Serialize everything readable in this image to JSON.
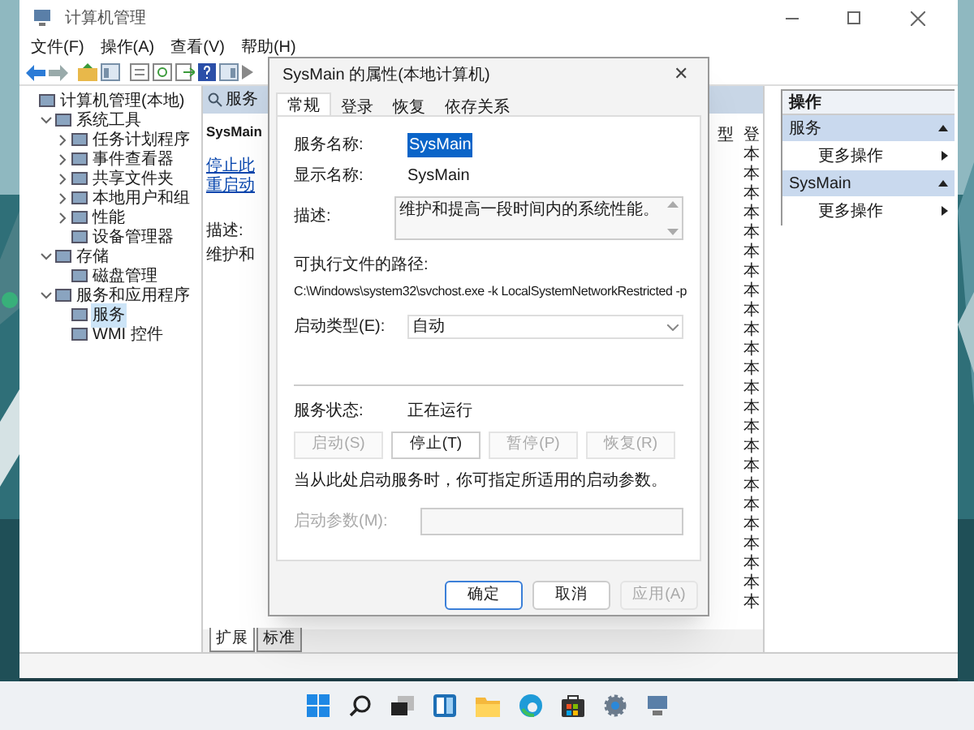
{
  "window": {
    "title": "计算机管理"
  },
  "menu": [
    "文件(F)",
    "操作(A)",
    "查看(V)",
    "帮助(H)"
  ],
  "tree": {
    "label": "计算机管理(本地)",
    "selected": false,
    "children": [
      {
        "label": "系统工具",
        "expanded": true,
        "selected": false,
        "children": [
          {
            "label": "任务计划程序",
            "expanded": false,
            "selected": false
          },
          {
            "label": "事件查看器",
            "expanded": false,
            "selected": false
          },
          {
            "label": "共享文件夹",
            "expanded": false,
            "selected": false
          },
          {
            "label": "本地用户和组",
            "expanded": false,
            "selected": false
          },
          {
            "label": "性能",
            "expanded": false,
            "selected": false
          },
          {
            "label": "设备管理器",
            "selected": false
          }
        ]
      },
      {
        "label": "存储",
        "expanded": true,
        "selected": false,
        "children": [
          {
            "label": "磁盘管理",
            "selected": false
          }
        ]
      },
      {
        "label": "服务和应用程序",
        "expanded": true,
        "selected": false,
        "children": [
          {
            "label": "服务",
            "selected": true
          },
          {
            "label": "WMI 控件",
            "selected": false
          }
        ]
      }
    ]
  },
  "services_panel": {
    "header": "服务",
    "title": "SysMain",
    "links": [
      "停止此",
      "重启动"
    ],
    "description_label": "描述:",
    "description": "维护和",
    "column_headers": [
      "型",
      "登"
    ],
    "column_2": [
      "本",
      "本",
      "本",
      "本",
      "本",
      "本",
      "本",
      "本",
      "本",
      "本",
      "本",
      "本",
      "本",
      "本",
      "本",
      "本",
      "本",
      "本",
      "本",
      "本",
      "本",
      "本",
      "本",
      "本"
    ],
    "bottom_tabs": [
      {
        "label": "扩展",
        "selected": true
      },
      {
        "label": "标准",
        "selected": false
      }
    ]
  },
  "actions": {
    "title": "操作",
    "sections": [
      {
        "title": "服务",
        "expanded": true,
        "items": [
          "更多操作"
        ]
      },
      {
        "title": "SysMain",
        "expanded": true,
        "items": [
          "更多操作"
        ]
      }
    ]
  },
  "dialog": {
    "title": "SysMain 的属性(本地计算机)",
    "close": "✕",
    "tabs": [
      {
        "label": "常规",
        "selected": true
      },
      {
        "label": "登录",
        "selected": false
      },
      {
        "label": "恢复",
        "selected": false
      },
      {
        "label": "依存关系",
        "selected": false
      }
    ],
    "service_name_label": "服务名称:",
    "service_name": "SysMain",
    "display_name_label": "显示名称:",
    "display_name": "SysMain",
    "description_label": "描述:",
    "description": "维护和提高一段时间内的系统性能。",
    "path_label": "可执行文件的路径:",
    "path": "C:\\Windows\\system32\\svchost.exe -k LocalSystemNetworkRestricted -p",
    "startup_type_label": "启动类型(E):",
    "startup_type": "自动",
    "status_label": "服务状态:",
    "status": "正在运行",
    "service_buttons": [
      {
        "label": "启动(S)",
        "disabled": true
      },
      {
        "label": "停止(T)",
        "disabled": false
      },
      {
        "label": "暂停(P)",
        "disabled": true
      },
      {
        "label": "恢复(R)",
        "disabled": true
      }
    ],
    "note": "当从此处启动服务时，你可指定所适用的启动参数。",
    "params_label": "启动参数(M):",
    "params_disabled": true,
    "footer_buttons": [
      {
        "label": "确定",
        "default": true,
        "disabled": false
      },
      {
        "label": "取消",
        "default": false,
        "disabled": false
      },
      {
        "label": "应用(A)",
        "default": false,
        "disabled": true
      }
    ]
  }
}
